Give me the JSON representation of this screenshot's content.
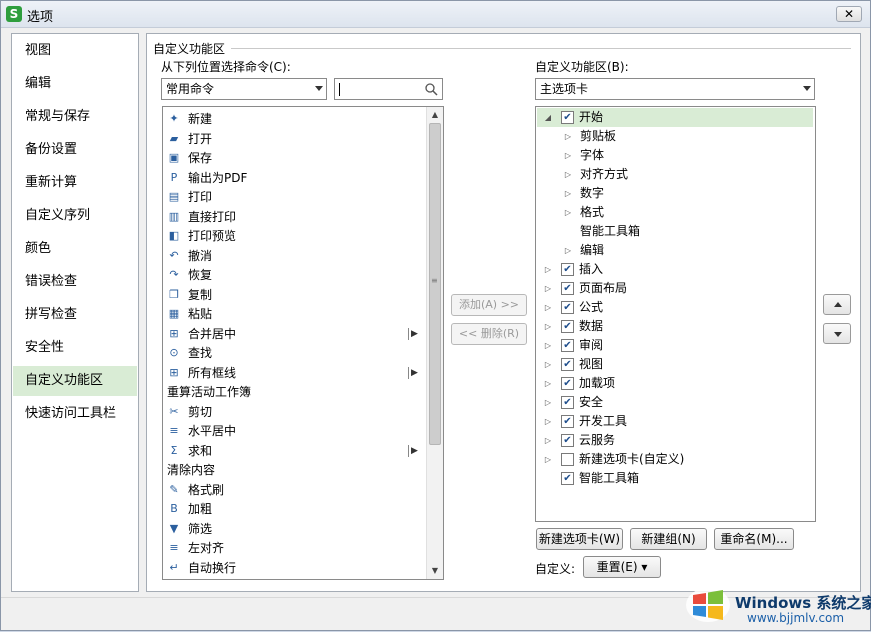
{
  "window": {
    "title": "选项",
    "app_icon": "S",
    "close_label": "✕"
  },
  "sidebar": {
    "items": [
      {
        "label": "视图"
      },
      {
        "label": "编辑"
      },
      {
        "label": "常规与保存"
      },
      {
        "label": "备份设置"
      },
      {
        "label": "重新计算"
      },
      {
        "label": "自定义序列"
      },
      {
        "label": "颜色"
      },
      {
        "label": "错误检查"
      },
      {
        "label": "拼写检查"
      },
      {
        "label": "安全性"
      },
      {
        "label": "自定义功能区"
      },
      {
        "label": "快速访问工具栏"
      }
    ],
    "active_index": 10
  },
  "panel": {
    "group_title": "自定义功能区",
    "left_label": "从下列位置选择命令(C):",
    "left_combo_value": "常用命令",
    "search_value": "",
    "right_label": "自定义功能区(B):",
    "right_combo_value": "主选项卡"
  },
  "commands": [
    {
      "label": "新建",
      "icon": "new-file-icon",
      "glyph": "✦"
    },
    {
      "label": "打开",
      "icon": "folder-open-icon",
      "glyph": "▰"
    },
    {
      "label": "保存",
      "icon": "save-icon",
      "glyph": "▣"
    },
    {
      "label": "输出为PDF",
      "icon": "pdf-icon",
      "glyph": "P"
    },
    {
      "label": "打印",
      "icon": "print-icon",
      "glyph": "▤"
    },
    {
      "label": "直接打印",
      "icon": "direct-print-icon",
      "glyph": "▥"
    },
    {
      "label": "打印预览",
      "icon": "print-preview-icon",
      "glyph": "◧"
    },
    {
      "label": "撤消",
      "icon": "undo-icon",
      "glyph": "↶"
    },
    {
      "label": "恢复",
      "icon": "redo-icon",
      "glyph": "↷"
    },
    {
      "label": "复制",
      "icon": "copy-icon",
      "glyph": "❐"
    },
    {
      "label": "粘贴",
      "icon": "paste-icon",
      "glyph": "▦"
    },
    {
      "label": "合并居中",
      "icon": "merge-center-icon",
      "glyph": "⊞",
      "submenu": true
    },
    {
      "label": "查找",
      "icon": "find-icon",
      "glyph": "⊙"
    },
    {
      "label": "所有框线",
      "icon": "all-borders-icon",
      "glyph": "⊞",
      "submenu": true
    },
    {
      "label": "重算活动工作簿",
      "icon": "",
      "glyph": ""
    },
    {
      "label": "剪切",
      "icon": "cut-icon",
      "glyph": "✂"
    },
    {
      "label": "水平居中",
      "icon": "align-center-icon",
      "glyph": "≡"
    },
    {
      "label": "求和",
      "icon": "sum-icon",
      "glyph": "Σ",
      "submenu": true
    },
    {
      "label": "清除内容",
      "icon": "",
      "glyph": ""
    },
    {
      "label": "格式刷",
      "icon": "format-painter-icon",
      "glyph": "✎"
    },
    {
      "label": "加粗",
      "icon": "bold-icon",
      "glyph": "B"
    },
    {
      "label": "筛选",
      "icon": "filter-icon",
      "glyph": "▼"
    },
    {
      "label": "左对齐",
      "icon": "align-left-icon",
      "glyph": "≡"
    },
    {
      "label": "自动换行",
      "icon": "wrap-text-icon",
      "glyph": "↵"
    }
  ],
  "buttons": {
    "add": "添加(A) >>",
    "remove": "<< 删除(R)",
    "new_tab": "新建选项卡(W)",
    "new_group": "新建组(N)",
    "rename": "重命名(M)...",
    "customize_label": "自定义:",
    "reset": "重置(E) ▾"
  },
  "tree": [
    {
      "label": "开始",
      "level": 0,
      "expander": "◢",
      "checked": true,
      "selected": true
    },
    {
      "label": "剪贴板",
      "level": 1,
      "expander": "▷"
    },
    {
      "label": "字体",
      "level": 1,
      "expander": "▷"
    },
    {
      "label": "对齐方式",
      "level": 1,
      "expander": "▷"
    },
    {
      "label": "数字",
      "level": 1,
      "expander": "▷"
    },
    {
      "label": "格式",
      "level": 1,
      "expander": "▷"
    },
    {
      "label": "智能工具箱",
      "level": 1,
      "expander": ""
    },
    {
      "label": "编辑",
      "level": 1,
      "expander": "▷"
    },
    {
      "label": "插入",
      "level": 0,
      "expander": "▷",
      "checked": true
    },
    {
      "label": "页面布局",
      "level": 0,
      "expander": "▷",
      "checked": true
    },
    {
      "label": "公式",
      "level": 0,
      "expander": "▷",
      "checked": true
    },
    {
      "label": "数据",
      "level": 0,
      "expander": "▷",
      "checked": true
    },
    {
      "label": "审阅",
      "level": 0,
      "expander": "▷",
      "checked": true
    },
    {
      "label": "视图",
      "level": 0,
      "expander": "▷",
      "checked": true
    },
    {
      "label": "加载项",
      "level": 0,
      "expander": "▷",
      "checked": true
    },
    {
      "label": "安全",
      "level": 0,
      "expander": "▷",
      "checked": true
    },
    {
      "label": "开发工具",
      "level": 0,
      "expander": "▷",
      "checked": true
    },
    {
      "label": "云服务",
      "level": 0,
      "expander": "▷",
      "checked": true
    },
    {
      "label": "新建选项卡(自定义)",
      "level": 0,
      "expander": "▷",
      "checked": false
    },
    {
      "label": "智能工具箱",
      "level": 0,
      "expander": "",
      "checked": true
    }
  ],
  "watermark": {
    "text1": "Windows 系统之家",
    "text2": "www.bjjmlv.com"
  },
  "colors": {
    "selection": "#d9ecd5",
    "check": "#1f4e8c"
  }
}
